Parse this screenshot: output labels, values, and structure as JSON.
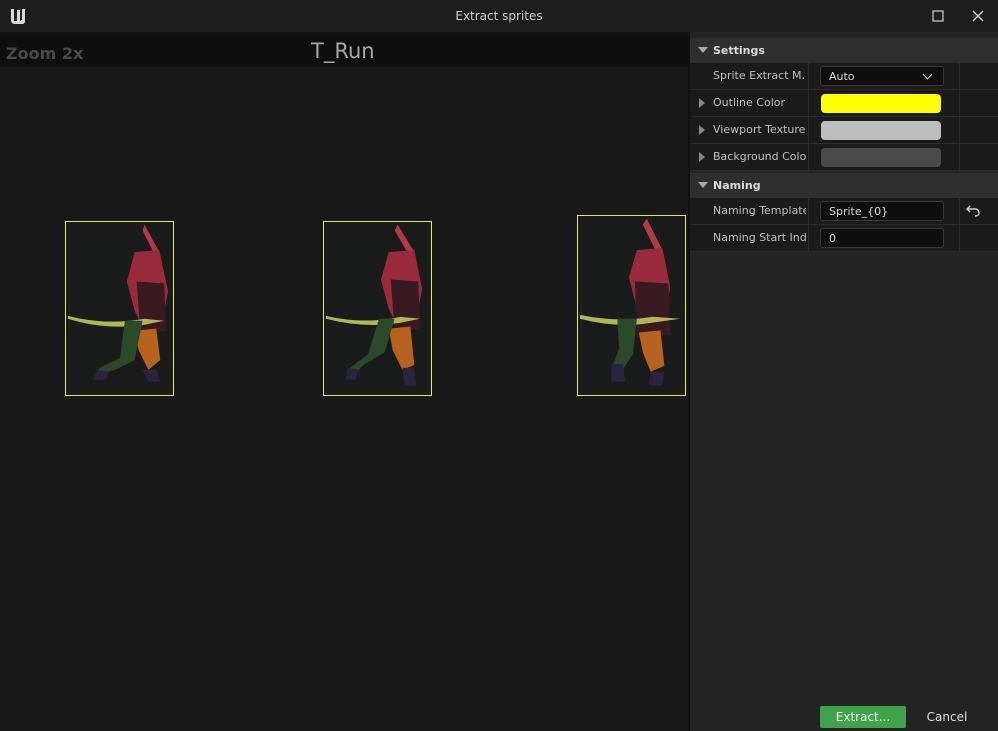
{
  "window": {
    "title": "Extract sprites"
  },
  "viewport": {
    "zoom_label": "Zoom 2x",
    "texture_name": "T_Run"
  },
  "settings": {
    "category_label": "Settings",
    "rows": [
      {
        "label": "Sprite Extract M...",
        "value": "Auto"
      },
      {
        "label": "Outline Color",
        "color": "#ffff00"
      },
      {
        "label": "Viewport Texture...",
        "color": "#bdbdbd"
      },
      {
        "label": "Background Color",
        "color": "#4a4a4a"
      }
    ]
  },
  "naming": {
    "category_label": "Naming",
    "rows": [
      {
        "label": "Naming Template",
        "value": "Sprite_{0}"
      },
      {
        "label": "Naming Start Ind...",
        "value": "0"
      }
    ]
  },
  "buttons": {
    "extract": "Extract...",
    "cancel": "Cancel"
  }
}
